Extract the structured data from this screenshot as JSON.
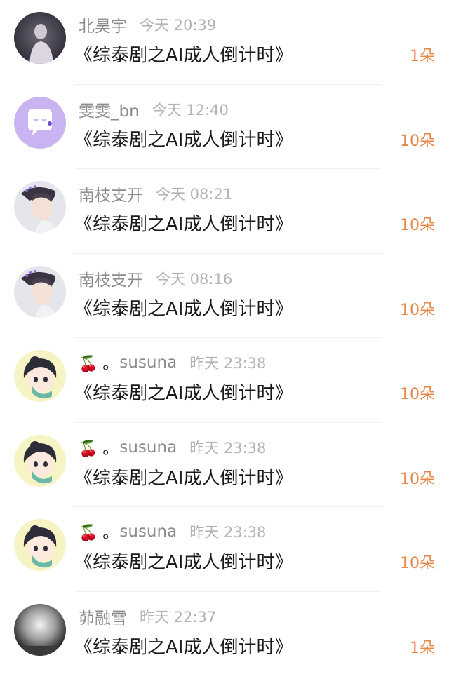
{
  "items": [
    {
      "user": "北昊宇",
      "prefix": "",
      "time": "今天 20:39",
      "title": "《综泰剧之AI成人倒计时》",
      "count": "1朵",
      "avatar": "dark-portrait"
    },
    {
      "user": "雯雯_bn",
      "prefix": "",
      "time": "今天 12:40",
      "title": "《综泰剧之AI成人倒计时》",
      "count": "10朵",
      "avatar": "purple-chat"
    },
    {
      "user": "南枝支开",
      "prefix": "",
      "time": "今天 08:21",
      "title": "《综泰剧之AI成人倒计时》",
      "count": "10朵",
      "avatar": "man-portrait"
    },
    {
      "user": "南枝支开",
      "prefix": "",
      "time": "今天 08:16",
      "title": "《综泰剧之AI成人倒计时》",
      "count": "10朵",
      "avatar": "man-portrait"
    },
    {
      "user": "susuna",
      "prefix": "🍒 。",
      "time": "昨天 23:38",
      "title": "《综泰剧之AI成人倒计时》",
      "count": "10朵",
      "avatar": "cartoon"
    },
    {
      "user": "susuna",
      "prefix": "🍒 。",
      "time": "昨天 23:38",
      "title": "《综泰剧之AI成人倒计时》",
      "count": "10朵",
      "avatar": "cartoon"
    },
    {
      "user": "susuna",
      "prefix": "🍒 。",
      "time": "昨天 23:38",
      "title": "《综泰剧之AI成人倒计时》",
      "count": "10朵",
      "avatar": "cartoon"
    },
    {
      "user": "茆融雪",
      "prefix": "",
      "time": "昨天 22:37",
      "title": "《综泰剧之AI成人倒计时》",
      "count": "1朵",
      "avatar": "gray-sphere"
    }
  ]
}
